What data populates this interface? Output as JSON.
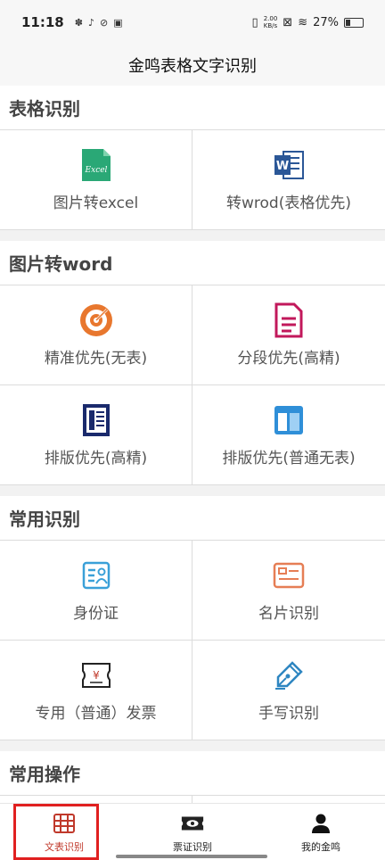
{
  "status_bar": {
    "time": "11:18",
    "net_speed_value": "2.00",
    "net_speed_unit": "KB/s",
    "battery": "27%",
    "battery_level": 0.27
  },
  "app_bar": {
    "title": "金鸣表格文字识别"
  },
  "sections": [
    {
      "title": "表格识别",
      "items": [
        {
          "label": "图片转excel",
          "icon": "excel-file-icon",
          "icon_text": "Excel"
        },
        {
          "label": "转wrod(表格优先)",
          "icon": "word-doc-icon",
          "icon_text": "W"
        }
      ]
    },
    {
      "title": "图片转word",
      "items": [
        {
          "label": "精准优先(无表)",
          "icon": "target-icon"
        },
        {
          "label": "分段优先(高精)",
          "icon": "document-lines-icon"
        },
        {
          "label": "排版优先(高精)",
          "icon": "layout-page-icon"
        },
        {
          "label": "排版优先(普通无表)",
          "icon": "layout-grid-icon"
        }
      ]
    },
    {
      "title": "常用识别",
      "items": [
        {
          "label": "身份证",
          "icon": "id-card-icon"
        },
        {
          "label": "名片识别",
          "icon": "business-card-icon"
        },
        {
          "label": "专用（普通）发票",
          "icon": "invoice-ticket-icon",
          "icon_text": "¥"
        },
        {
          "label": "手写识别",
          "icon": "pen-nib-icon"
        }
      ]
    },
    {
      "title": "常用操作",
      "items": []
    }
  ],
  "bottom_nav": [
    {
      "label": "文表识别",
      "icon": "table-grid-icon",
      "active": true
    },
    {
      "label": "票证识别",
      "icon": "ticket-eye-icon",
      "active": false
    },
    {
      "label": "我的金鸣",
      "icon": "user-icon",
      "active": false
    }
  ],
  "colors": {
    "accent_red": "#c0392b",
    "excel_green": "#2aa876",
    "word_blue": "#2b5797",
    "target_orange": "#e8772e",
    "doc_magenta": "#c2185b",
    "navy": "#1a2a6c",
    "sky_blue": "#2f8fd8",
    "id_blue": "#3aa0d8",
    "card_orange": "#e67e55",
    "pen_blue": "#2e86c1"
  }
}
